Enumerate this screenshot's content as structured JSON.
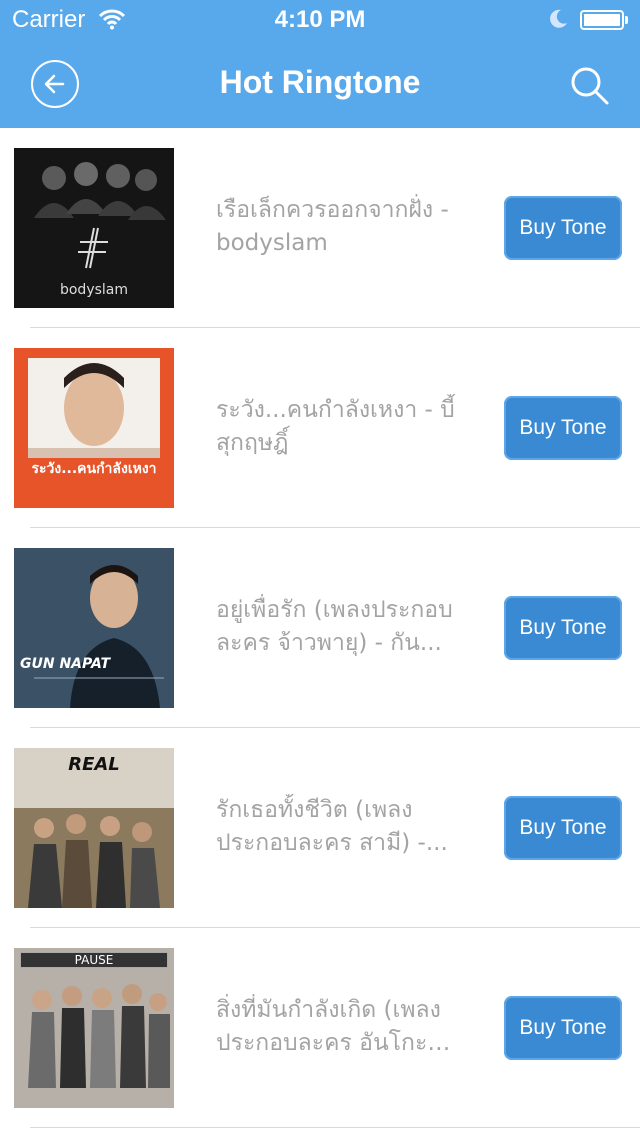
{
  "status_bar": {
    "carrier": "Carrier",
    "time": "4:10 PM"
  },
  "nav": {
    "title": "Hot Ringtone"
  },
  "colors": {
    "nav_bar": "#58a8ec",
    "buy_button": "#3a8ad3",
    "title_text": "#a3a3a3"
  },
  "songs": [
    {
      "title": "เรือเล็กควรออกจากฝั่ง - bodyslam",
      "button": "Buy Tone",
      "cover_caption": "bodyslam"
    },
    {
      "title": "ระวัง...คนกำลังเหงา - บี้ สุกฤษฎิ์",
      "button": "Buy Tone",
      "cover_caption": "ระวัง...คนกำลังเหงา"
    },
    {
      "title": "อยู่เพื่อรัก (เพลงประกอบละคร จ้าวพายุ) - กัน...",
      "button": "Buy Tone",
      "cover_caption": "GUN NAPAT"
    },
    {
      "title": "รักเธอทั้งชีวิต (เพลงประกอบละคร สามี) -...",
      "button": "Buy Tone",
      "cover_caption": "REAL"
    },
    {
      "title": "สิ่งที่มันกำลังเกิด (เพลงประกอบละคร อันโกะ ก...",
      "button": "Buy Tone",
      "cover_caption": "PAUSE"
    }
  ]
}
